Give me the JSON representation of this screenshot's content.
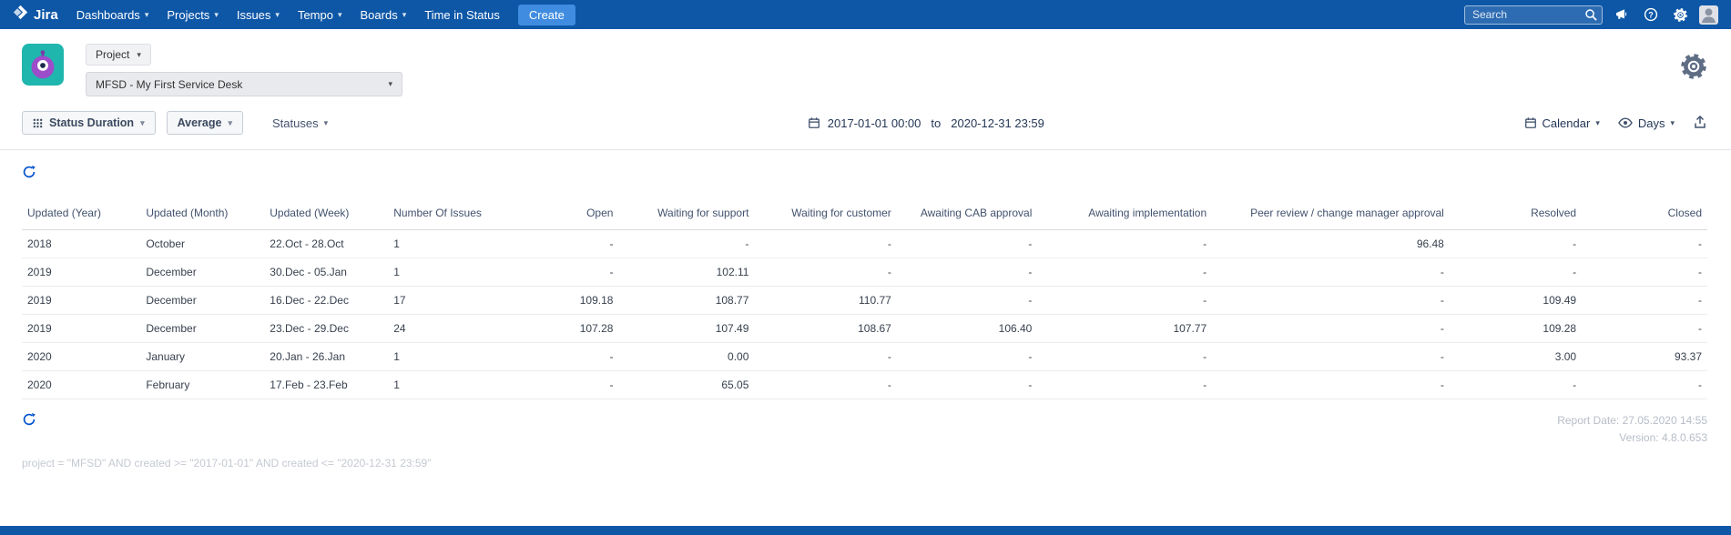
{
  "navbar": {
    "brand": "Jira",
    "items": [
      {
        "label": "Dashboards",
        "has_dropdown": true
      },
      {
        "label": "Projects",
        "has_dropdown": true
      },
      {
        "label": "Issues",
        "has_dropdown": true
      },
      {
        "label": "Tempo",
        "has_dropdown": true
      },
      {
        "label": "Boards",
        "has_dropdown": true
      },
      {
        "label": "Time in Status",
        "has_dropdown": false
      }
    ],
    "create_label": "Create",
    "search_placeholder": "Search"
  },
  "header": {
    "scope_label": "Project",
    "project_selected": "MFSD - My First Service Desk"
  },
  "toolbar": {
    "report_type": "Status Duration",
    "metric": "Average",
    "statuses_label": "Statuses",
    "date_from": "2017-01-01 00:00",
    "date_separator": "to",
    "date_to": "2020-12-31 23:59",
    "calendar_mode": "Calendar",
    "unit": "Days"
  },
  "table": {
    "columns": [
      "Updated (Year)",
      "Updated (Month)",
      "Updated (Week)",
      "Number Of Issues",
      "Open",
      "Waiting for support",
      "Waiting for customer",
      "Awaiting CAB approval",
      "Awaiting implementation",
      "Peer review / change manager approval",
      "Resolved",
      "Closed"
    ],
    "rows": [
      [
        "2018",
        "October",
        "22.Oct - 28.Oct",
        "1",
        "-",
        "-",
        "-",
        "-",
        "-",
        "96.48",
        "-",
        "-"
      ],
      [
        "2019",
        "December",
        "30.Dec - 05.Jan",
        "1",
        "-",
        "102.11",
        "-",
        "-",
        "-",
        "-",
        "-",
        "-"
      ],
      [
        "2019",
        "December",
        "16.Dec - 22.Dec",
        "17",
        "109.18",
        "108.77",
        "110.77",
        "-",
        "-",
        "-",
        "109.49",
        "-"
      ],
      [
        "2019",
        "December",
        "23.Dec - 29.Dec",
        "24",
        "107.28",
        "107.49",
        "108.67",
        "106.40",
        "107.77",
        "-",
        "109.28",
        "-"
      ],
      [
        "2020",
        "January",
        "20.Jan - 26.Jan",
        "1",
        "-",
        "0.00",
        "-",
        "-",
        "-",
        "-",
        "3.00",
        "93.37"
      ],
      [
        "2020",
        "February",
        "17.Feb - 23.Feb",
        "1",
        "-",
        "65.05",
        "-",
        "-",
        "-",
        "-",
        "-",
        "-"
      ]
    ]
  },
  "footer": {
    "report_date": "Report Date: 27.05.2020 14:55",
    "version": "Version: 4.8.0.653",
    "jql": "project = \"MFSD\" AND created >= \"2017-01-01\" AND created <= \"2020-12-31 23:59\""
  },
  "colors": {
    "navbar": "#0e57a7",
    "accent": "#0052cc",
    "create_button": "#3f8ce0",
    "app_icon_teal": "#1fb6ae",
    "app_icon_purple": "#9b4dca"
  }
}
